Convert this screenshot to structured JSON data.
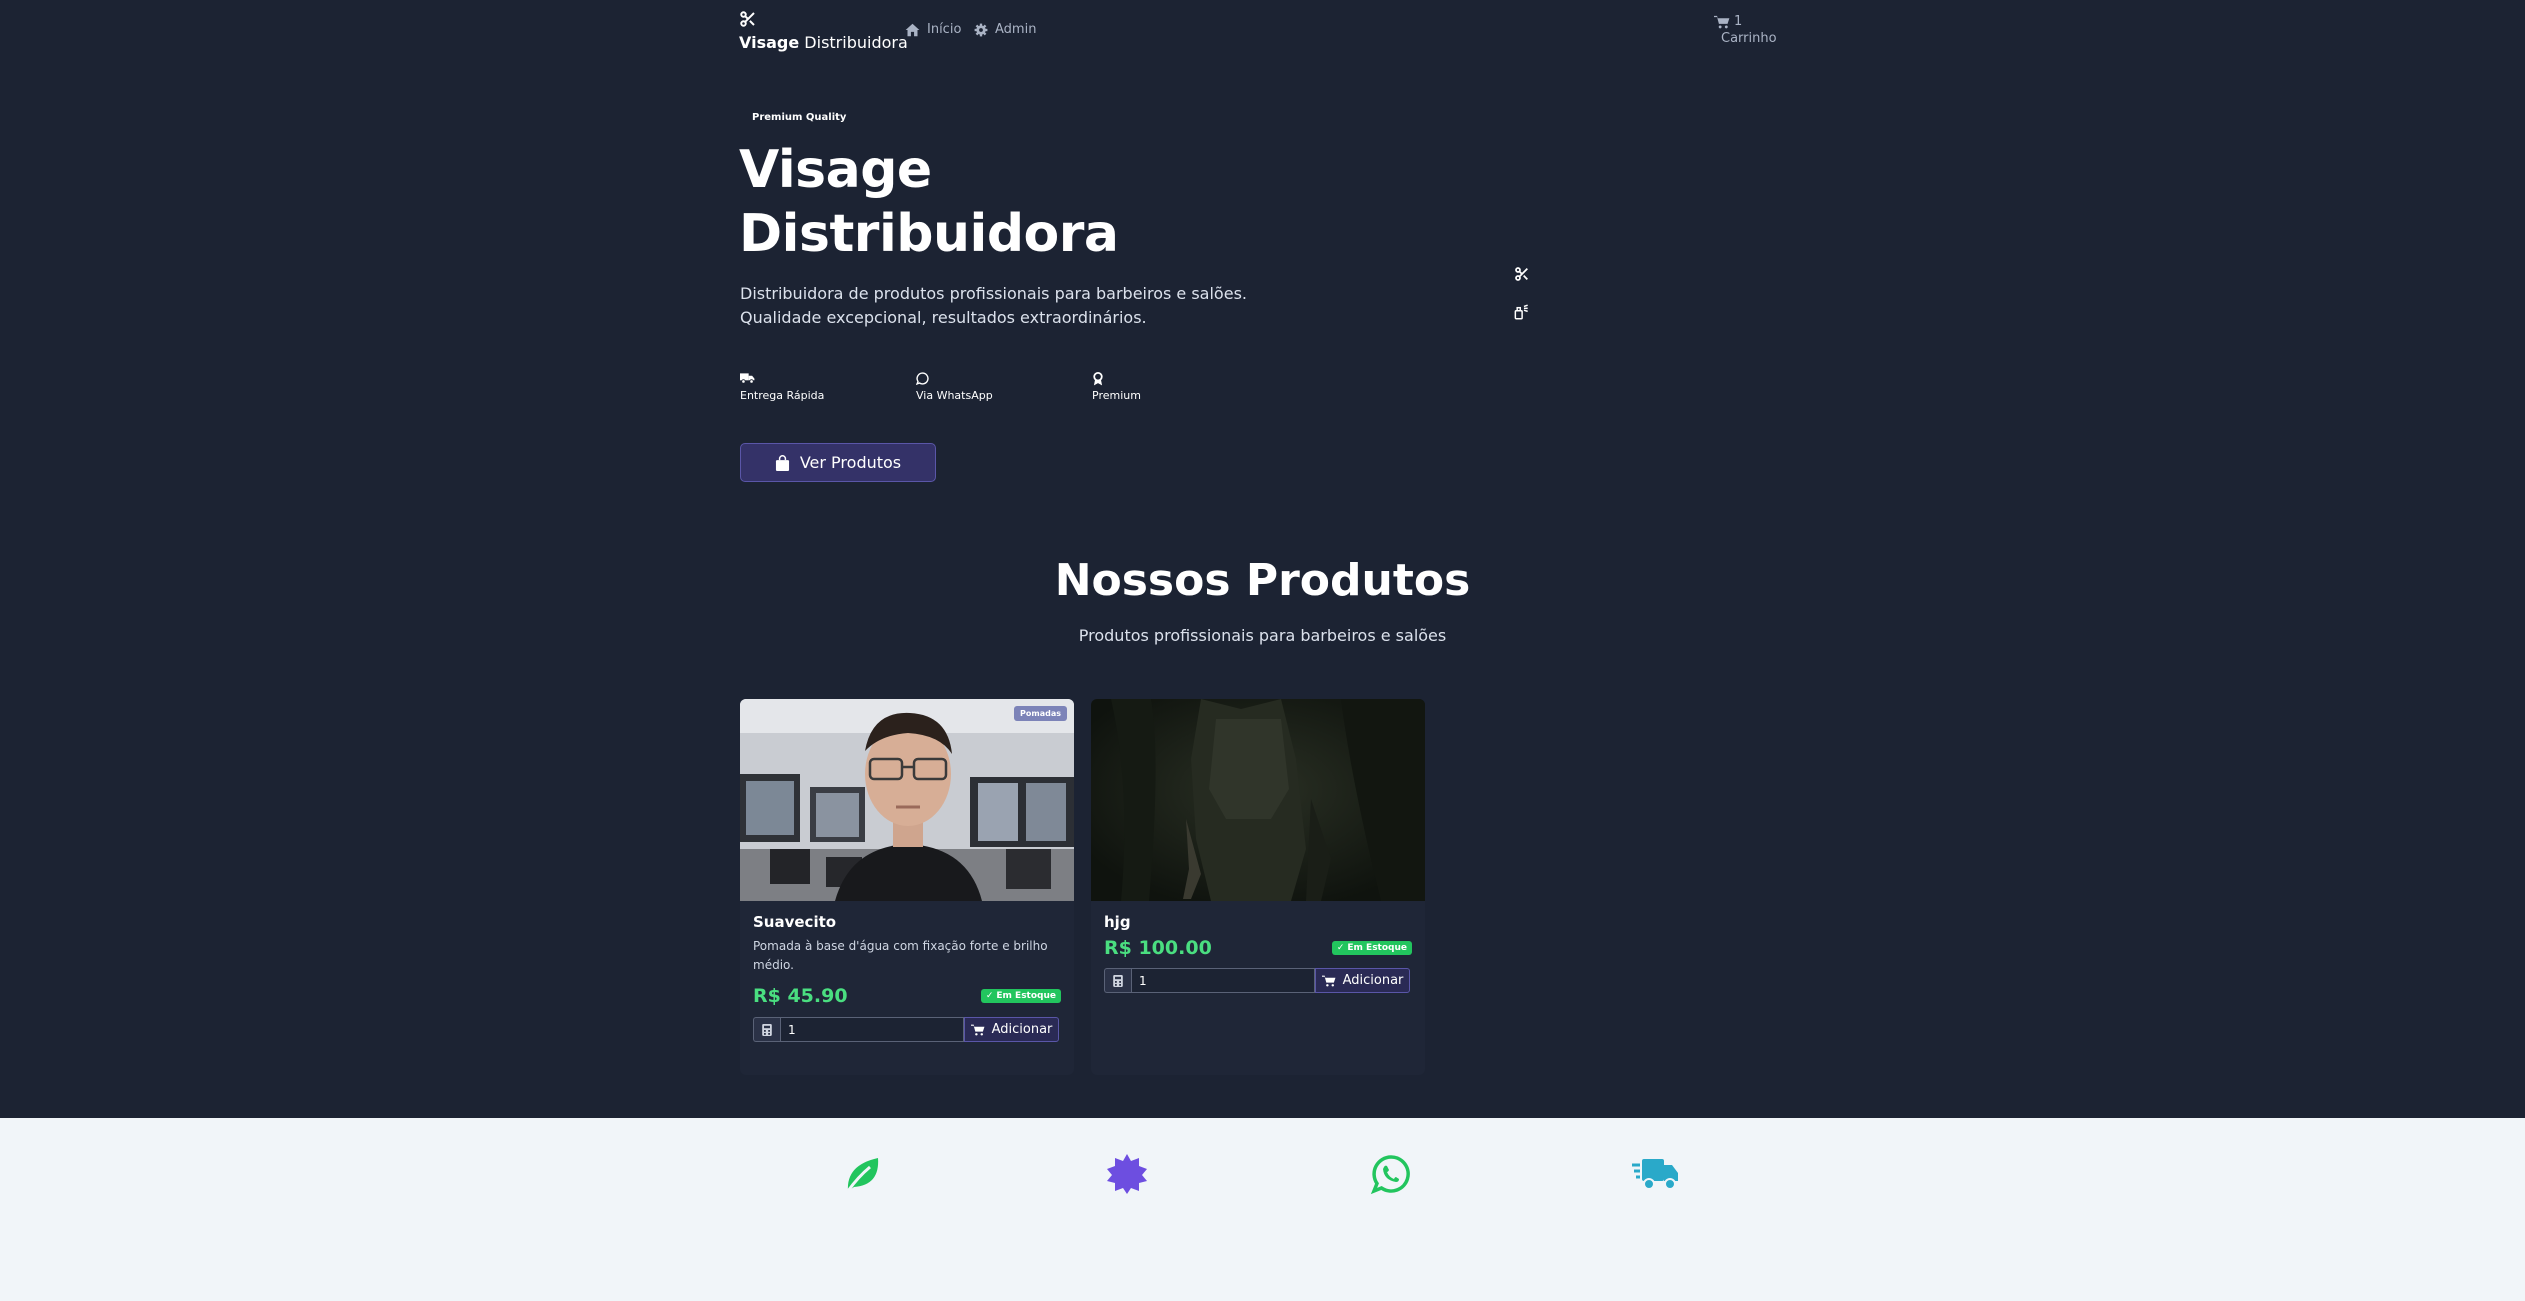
{
  "nav": {
    "brand_bold": "Visage",
    "brand_rest": " Distribuidora",
    "links": [
      {
        "label": "Início",
        "icon": "home-icon"
      },
      {
        "label": "Admin",
        "icon": "gear-icon"
      }
    ],
    "cart_count": "1",
    "cart_label": "Carrinho"
  },
  "hero": {
    "badge": "Premium Quality",
    "title_line1": "Visage",
    "title_line2": "Distribuidora",
    "desc_line1": "Distribuidora de produtos profissionais para barbeiros e salões.",
    "desc_line2": "Qualidade excepcional, resultados extraordinários.",
    "features": [
      {
        "label": "Entrega Rápida",
        "icon": "truck-icon"
      },
      {
        "label": "Via WhatsApp",
        "icon": "whatsapp-icon"
      },
      {
        "label": "Premium",
        "icon": "award-icon"
      }
    ],
    "cta": "Ver Produtos"
  },
  "products_section": {
    "title": "Nossos Produtos",
    "subtitle": "Produtos profissionais para barbeiros e salões",
    "products": [
      {
        "name": "Suavecito",
        "description": "Pomada à base d'água com fixação forte e brilho médio.",
        "price": "R$ 45.90",
        "stock": "Em Estoque",
        "category": "Pomadas",
        "qty": "1",
        "add_label": "Adicionar"
      },
      {
        "name": "hjg",
        "description": "",
        "price": "R$ 100.00",
        "stock": "Em Estoque",
        "qty": "1",
        "add_label": "Adicionar"
      }
    ]
  },
  "band_icons": [
    "leaf-icon",
    "badge-icon",
    "whatsapp-icon",
    "truck-fast-icon"
  ],
  "colors": {
    "bg": "#1c2333",
    "accent": "#343268",
    "price": "#4ade80",
    "stock": "#22c55e",
    "leaf": "#22c55e",
    "badge": "#6d4ee0",
    "whatsapp": "#22c55e",
    "truck": "#2aa9c9"
  }
}
